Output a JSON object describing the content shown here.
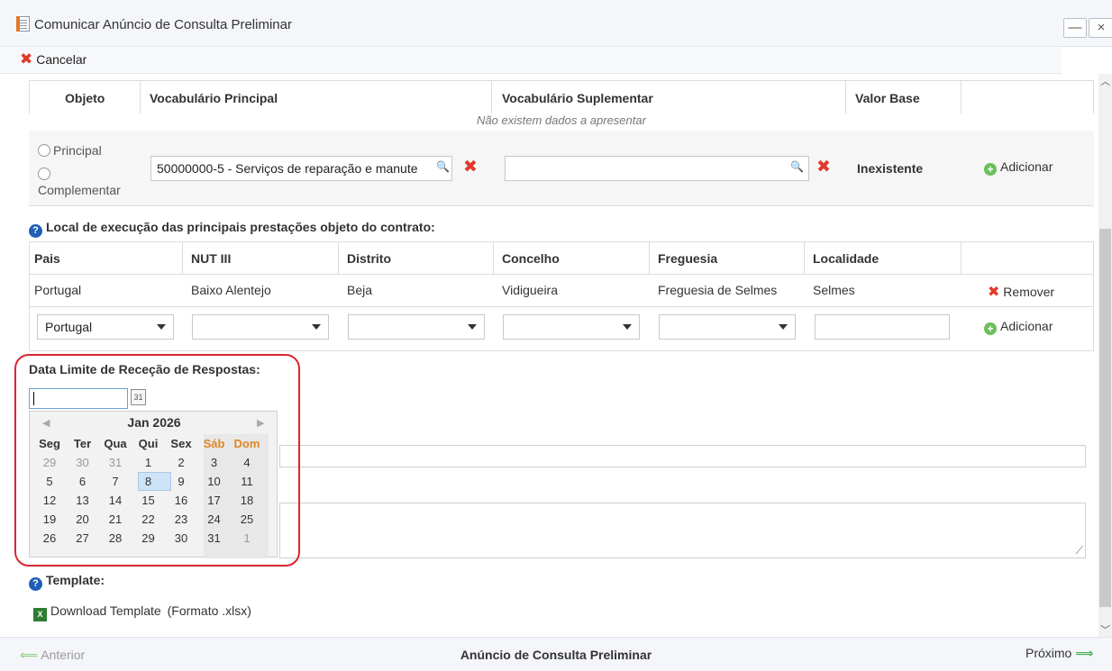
{
  "window": {
    "title": "Comunicar Anúncio de Consulta Preliminar",
    "minimize": "—",
    "close": "×"
  },
  "toolbar": {
    "cancel": "Cancelar"
  },
  "vocab_table": {
    "headers": [
      "Objeto",
      "Vocabulário Principal",
      "Vocabulário Suplementar",
      "Valor Base"
    ],
    "empty_message": "Não existem dados a apresentar",
    "radio_principal": "Principal",
    "radio_complementar": "Complementar",
    "principal_value": "50000000-5 - Serviços de reparação e manute",
    "supplementar_value": "",
    "valor_base": "Inexistente",
    "add": "Adicionar"
  },
  "location": {
    "section_title": "Local de execução das principais prestações objeto do contrato:",
    "headers": [
      "Pais",
      "NUT III",
      "Distrito",
      "Concelho",
      "Freguesia",
      "Localidade"
    ],
    "row": [
      "Portugal",
      "Baixo Alentejo",
      "Beja",
      "Vidigueira",
      "Freguesia de Selmes",
      "Selmes"
    ],
    "remove": "Remover",
    "country_select": "Portugal",
    "add": "Adicionar"
  },
  "deadline": {
    "label": "Data Limite de Receção de Respostas:",
    "value": ""
  },
  "calendar": {
    "month": "Jan 2026",
    "weekdays": [
      "Seg",
      "Ter",
      "Qua",
      "Qui",
      "Sex",
      "Sáb",
      "Dom"
    ],
    "weeks": [
      [
        "29",
        "30",
        "31",
        "1",
        "2",
        "3",
        "4"
      ],
      [
        "5",
        "6",
        "7",
        "8",
        "9",
        "10",
        "11"
      ],
      [
        "12",
        "13",
        "14",
        "15",
        "16",
        "17",
        "18"
      ],
      [
        "19",
        "20",
        "21",
        "22",
        "23",
        "24",
        "25"
      ],
      [
        "26",
        "27",
        "28",
        "29",
        "30",
        "31",
        "1"
      ]
    ],
    "today": "8"
  },
  "template": {
    "label": "Template:",
    "download": "Download Template",
    "format": "(Formato .xlsx)"
  },
  "footer": {
    "prev": "Anterior",
    "center": "Anúncio de Consulta Preliminar",
    "next": "Próximo"
  }
}
